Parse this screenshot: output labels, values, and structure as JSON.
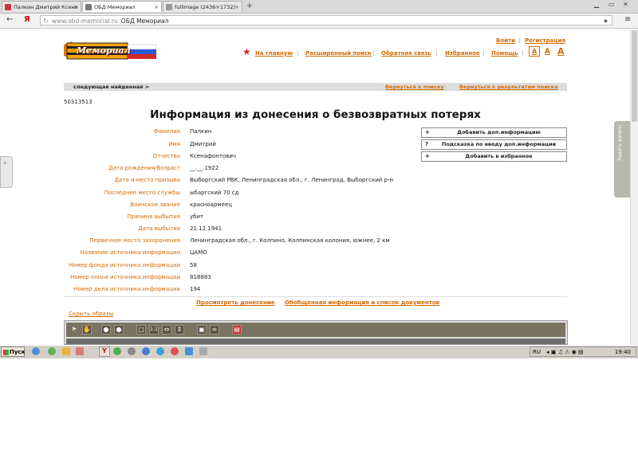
{
  "browser": {
    "tabs": [
      {
        "title": "Палкин Дмитрий Ксено",
        "active": false
      },
      {
        "title": "ОБД Мемориал",
        "active": true
      },
      {
        "title": "fullimage (2436×1732)",
        "active": false
      }
    ],
    "url": "www.obd-memorial.ru",
    "url_title": "ОБД Мемориал",
    "yandex_button": "Я"
  },
  "site": {
    "logo_text": "Мемориал",
    "login": "Войти",
    "register": "Регистрация",
    "nav": [
      "На главную",
      "Расширенный поиск",
      "Обратная связь",
      "Избранное",
      "Помощь"
    ],
    "font_sizes": [
      "A",
      "A",
      "A"
    ],
    "next_found": "следующая найденная >",
    "back_to_search": "Вернуться к поиску",
    "back_to_results": "Вернуться к результатам поиска"
  },
  "record": {
    "id": "50313513",
    "heading": "Информация из донесения о безвозвратных потерях",
    "fields": [
      {
        "label": "Фамилия",
        "value": "Палкин"
      },
      {
        "label": "Имя",
        "value": "Дмитрий"
      },
      {
        "label": "Отчество",
        "value": "Ксенафонтович"
      },
      {
        "label": "Дата рождения/Возраст",
        "value": "__.__.1922"
      },
      {
        "label": "Дата и место призыва",
        "value": "Выборгский РВК, Ленинградская обл., г. Ленинград, Выборгский р-н"
      },
      {
        "label": "Последнее место службы",
        "value": "ыбаргский 70 сд"
      },
      {
        "label": "Воинское звание",
        "value": "красноармеец"
      },
      {
        "label": "Причина выбытия",
        "value": "убит"
      },
      {
        "label": "Дата выбытия",
        "value": "21.12.1941"
      },
      {
        "label": "Первичное место захоронения",
        "value": "Ленинградская обл., г. Колпино, Колпинская колония, южнее, 2 км"
      },
      {
        "label": "Название источника информации",
        "value": "ЦАМО"
      },
      {
        "label": "Номер фонда источника информации",
        "value": "58"
      },
      {
        "label": "Номер описи источника информации",
        "value": "818883"
      },
      {
        "label": "Номер дела источника информации",
        "value": "194"
      }
    ],
    "actions": [
      {
        "icon": "+",
        "label": "Добавить доп.информацию"
      },
      {
        "icon": "?",
        "label": "Подсказка по вводу доп.информации"
      },
      {
        "icon": "+",
        "label": "Добавить в избранное"
      }
    ],
    "view_report": "Просмотреть донесение",
    "summary_docs": "Обобщенная информация и список документов",
    "hide_images": "Скрыть образы"
  },
  "feedback_tab": "Задать вопрос",
  "taskbar": {
    "start": "Пуск",
    "lang": "RU",
    "clock": "19:40"
  }
}
